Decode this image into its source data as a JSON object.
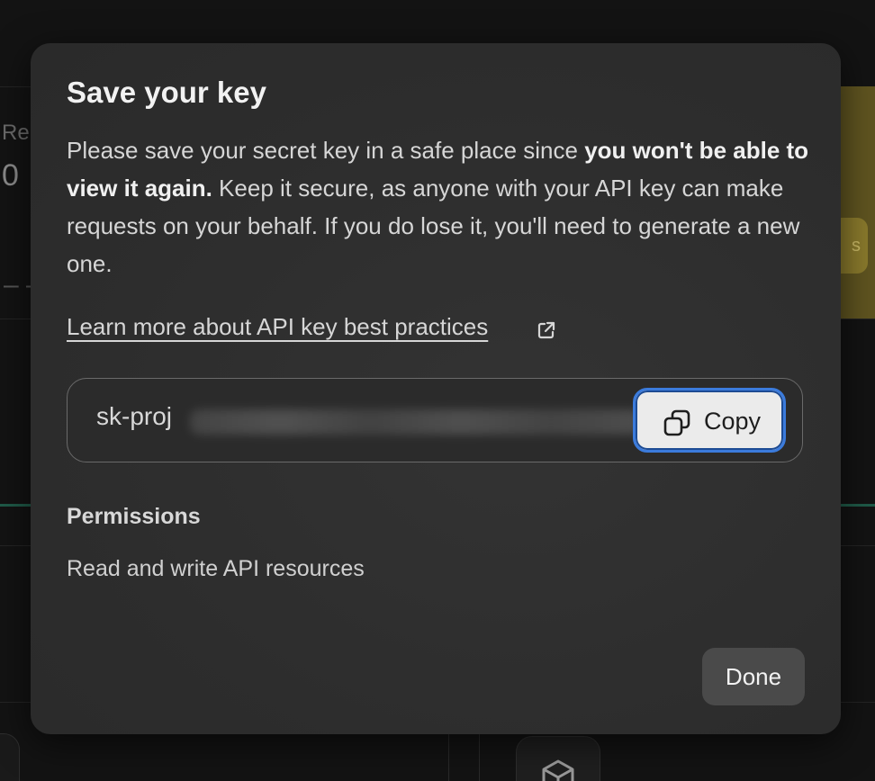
{
  "background": {
    "left_label": "Re",
    "left_number": "0",
    "left_dash": "– –",
    "yellow_button_fragment": "s",
    "cube_icon": "cube-icon"
  },
  "modal": {
    "title": "Save your key",
    "description": {
      "part1": "Please save your secret key in a safe place since ",
      "bold": "you won't be able to view it again.",
      "part2": " Keep it secure, as anyone with your API key can make requests on your behalf. If you do lose it, you'll need to generate a new one."
    },
    "learn_more_link": "Learn more about API key best practices",
    "external_link_icon": "external-link-icon",
    "key": {
      "visible_prefix": "sk-proj",
      "obscured": true
    },
    "copy_button": {
      "label": "Copy",
      "icon": "copy-icon"
    },
    "permissions": {
      "heading": "Permissions",
      "value": "Read and write API resources"
    },
    "done_button": "Done"
  },
  "colors": {
    "focus_ring": "#3b7bdc",
    "modal_bg": "#2e2e2e",
    "accent_yellow": "#8a7a2c",
    "accent_green": "#1f5a48"
  }
}
